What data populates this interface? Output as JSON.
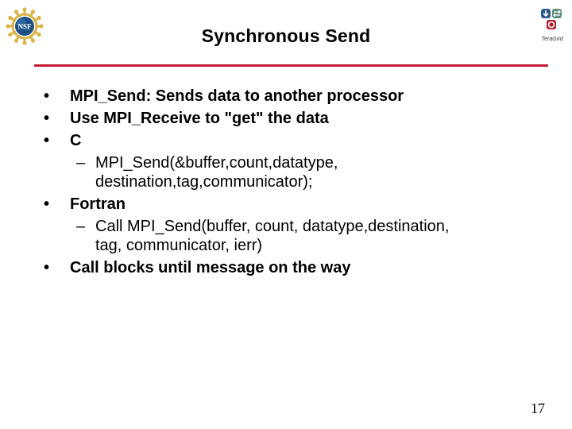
{
  "slide": {
    "title": "Synchronous Send",
    "accent_color": "#c41a35",
    "logos": {
      "left": "nsf-logo",
      "left_text": "NSF",
      "right": "teragrid-logo",
      "right_text": "TeraGrid"
    },
    "items": [
      {
        "level": 1,
        "marker": "•",
        "text": "MPI_Send: Sends data to another processor"
      },
      {
        "level": 1,
        "marker": "•",
        "text": "Use MPI_Receive to \"get\" the data"
      },
      {
        "level": 1,
        "marker": "•",
        "text": "C"
      },
      {
        "level": 2,
        "marker": "–",
        "text": "MPI_Send(&buffer,count,datatype,\ndestination,tag,communicator);"
      },
      {
        "level": 1,
        "marker": "•",
        "text": "Fortran"
      },
      {
        "level": 2,
        "marker": "–",
        "text": "Call MPI_Send(buffer, count, datatype,destination,\ntag, communicator, ierr)"
      },
      {
        "level": 1,
        "marker": "•",
        "text": "Call blocks until message on the way"
      }
    ],
    "page_number": "17"
  }
}
